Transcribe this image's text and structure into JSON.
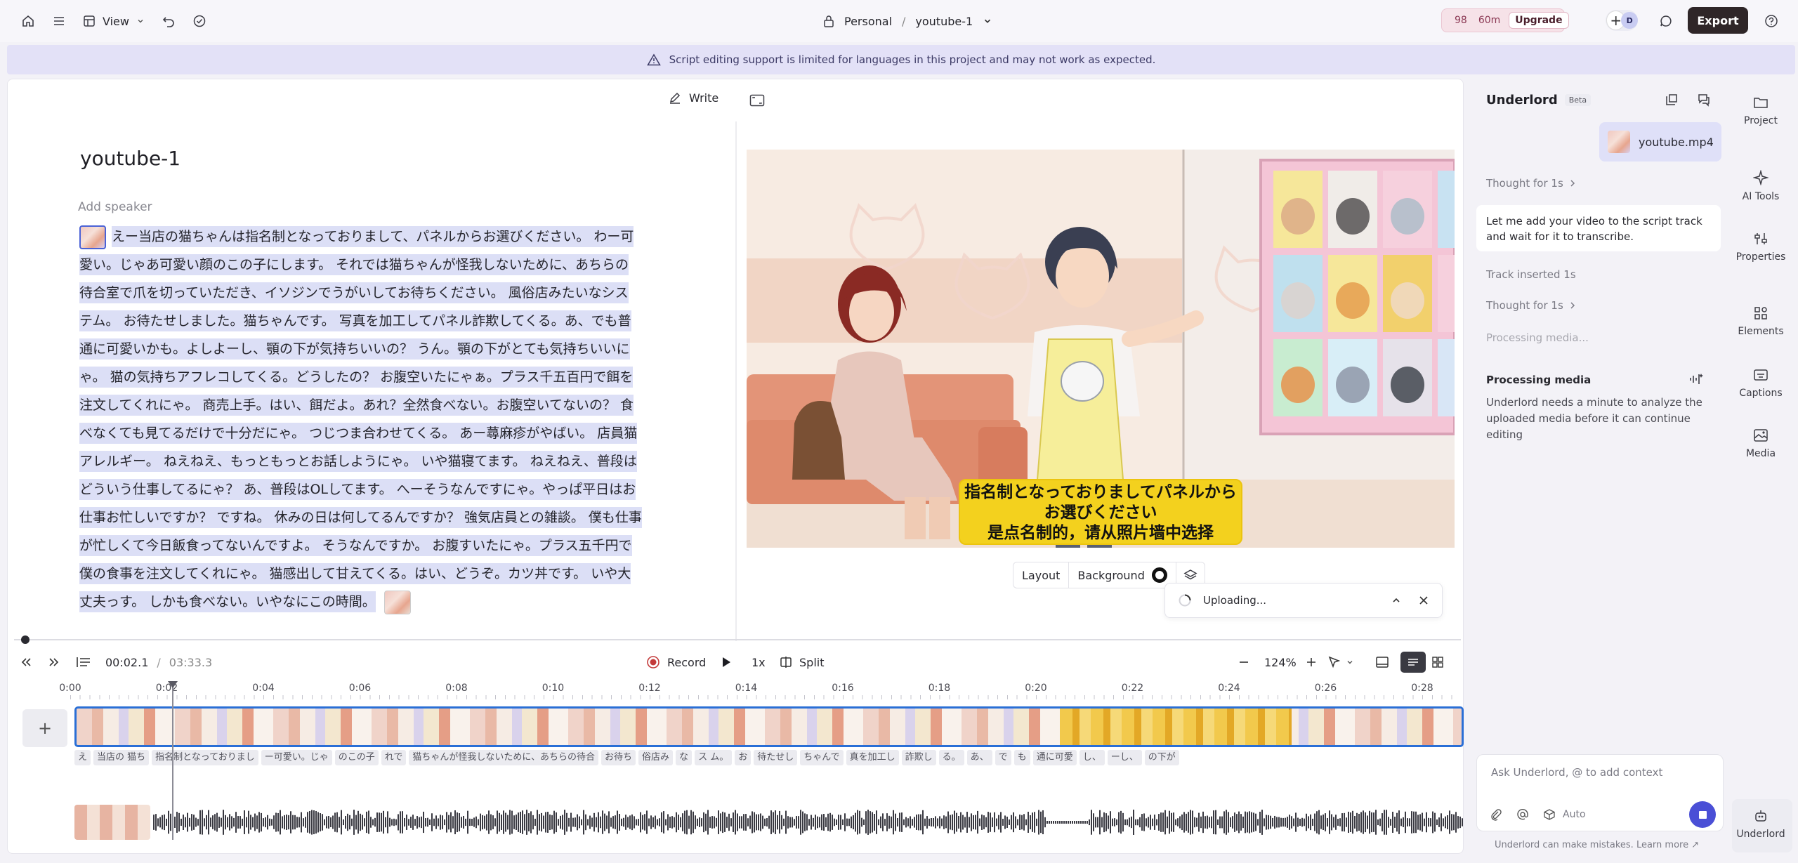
{
  "topbar": {
    "view_label": "View",
    "workspace": "Personal",
    "separator": "/",
    "project": "youtube-1",
    "credit_count": "98",
    "credit_time": "60m",
    "upgrade_label": "Upgrade",
    "avatar_initial": "D",
    "export_label": "Export"
  },
  "banner": {
    "text": "Script editing support is limited for languages in this project and may not work as expected."
  },
  "editor": {
    "write_label": "Write",
    "title": "youtube-1",
    "add_speaker": "Add speaker",
    "script_lines": [
      "えー当店の猫ちゃんは指名制となっておりまして、パネルからお選びください。 わー可",
      "愛い。じゃあ可愛い顔のこの子にします。 それでは猫ちゃんが怪我しないために、あちらの",
      "待合室で爪を切っていただき、イソジンでうがいしてお待ちください。 風俗店みたいなシス",
      "テム。 お待たせしました。猫ちゃんです。 写真を加工してパネル詐欺してくる。あ、でも普",
      "通に可愛いかも。よしよーし、顎の下が気持ちいいの？ うん。顎の下がとても気持ちいいに",
      "ゃ。 猫の気持ちアフレコしてくる。どうしたの？ お腹空いたにゃぁ。プラス千五百円で餌を",
      "注文してくれにゃ。 商売上手。はい、餌だよ。あれ？全然食べない。お腹空いてないの？ 食",
      "べなくても見てるだけで十分だにゃ。 つじつま合わせてくる。 あー蕁麻疹がやばい。 店員猫",
      "アレルギー。 ねえねえ、もっともっとお話しようにゃ。 いや猫寝てます。 ねえねえ、普段は",
      "どういう仕事してるにゃ？ あ、普段はOLしてます。 へーそうなんですにゃ。やっぱ平日はお",
      "仕事お忙しいですか？ ですね。 休みの日は何してるんですか？ 強気店員との雑談。 僕も仕事",
      "が忙しくて今日飯食ってないんですよ。 そうなんですか。 お腹すいたにゃ。プラス五千円で",
      "僕の食事を注文してくれにゃ。 猫感出して甘えてくる。はい、どうぞ。カツ丼です。 いや大",
      "丈夫っす。 しかも食べない。いやなにこの時間。"
    ]
  },
  "preview": {
    "subtitle_jp_1": "指名制となっておりましてパネルから",
    "subtitle_jp_2": "お選びください",
    "subtitle_zh": "是点名制的，请从照片墙中选择",
    "layout_label": "Layout",
    "background_label": "Background"
  },
  "upload": {
    "label": "Uploading..."
  },
  "transport": {
    "current_time": "00:02.1",
    "time_sep": "/",
    "total_time": "03:33.3",
    "record_label": "Record",
    "speed": "1x",
    "split_label": "Split",
    "zoom": "124%"
  },
  "timeline": {
    "ruler": [
      "0:00",
      "0:02",
      "0:04",
      "0:06",
      "0:08",
      "0:10",
      "0:12",
      "0:14",
      "0:16",
      "0:18",
      "0:20",
      "0:22",
      "0:24",
      "0:26",
      "0:28"
    ],
    "words": [
      "え",
      "当店の 猫ち",
      "指名制となっておりまし",
      "ー可愛い。じゃ",
      "のこの子",
      "れで",
      "猫ちゃんが怪我しないために、あちらの待合",
      "お待ち",
      "俗店み",
      "な",
      "ス ム。",
      "お",
      "待たせし",
      "ちゃんで",
      "真を加工し",
      "詐欺し",
      "る。",
      "あ、",
      "で",
      "も",
      "通に可愛",
      "し、",
      "ーし、",
      "の下が"
    ]
  },
  "underlord": {
    "title": "Underlord",
    "beta": "Beta",
    "file_name": "youtube.mp4",
    "thought_1": "Thought for 1s",
    "message": "Let me add your video to the script track and wait for it to transcribe.",
    "track_inserted": "Track inserted 1s",
    "thought_2": "Thought for 1s",
    "processing_status": "Processing media...",
    "processing_title": "Processing media",
    "processing_text": "Underlord needs a minute to analyze the uploaded media before it can continue editing",
    "ask_placeholder": "Ask Underlord, @ to add context",
    "auto_label": "Auto",
    "disclaimer": "Underlord can make mistakes. Learn more ↗"
  },
  "rail": {
    "project": "Project",
    "ai_tools": "AI Tools",
    "properties": "Properties",
    "elements": "Elements",
    "captions": "Captions",
    "media": "Media",
    "underlord": "Underlord"
  },
  "colors": {
    "accent": "#4a4fd6",
    "selection": "#dcdff6",
    "banner": "#e3e1f7",
    "export": "#2f2628",
    "subtitle": "#f3d11e",
    "track_border": "#2a6fd6"
  }
}
